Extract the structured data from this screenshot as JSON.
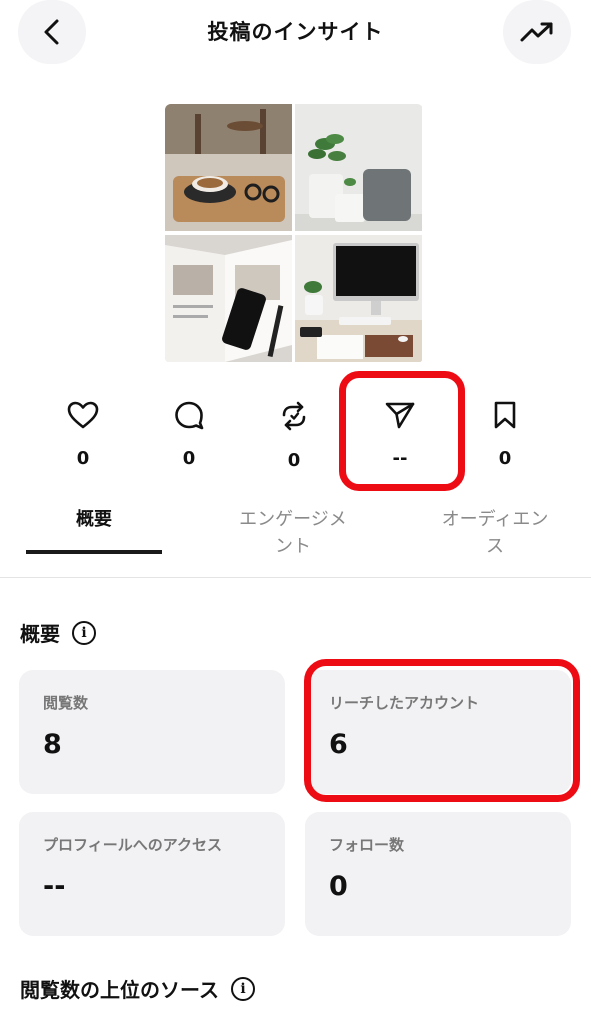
{
  "header": {
    "title": "投稿のインサイト",
    "back_icon": "chevron-left-icon",
    "trend_icon": "trending-up-icon"
  },
  "stats": [
    {
      "icon": "heart-icon",
      "value": "0"
    },
    {
      "icon": "comment-icon",
      "value": "0"
    },
    {
      "icon": "repost-icon",
      "value": "0"
    },
    {
      "icon": "share-icon",
      "value": "--"
    },
    {
      "icon": "bookmark-icon",
      "value": "0"
    }
  ],
  "tabs": [
    {
      "label": "概要"
    },
    {
      "label": "エンゲージメ\nント"
    },
    {
      "label": "オーディエン\nス"
    }
  ],
  "overview": {
    "title": "概要",
    "cards": [
      {
        "label": "閲覧数",
        "value": "8"
      },
      {
        "label": "リーチしたアカウント",
        "value": "6"
      },
      {
        "label": "プロフィールへのアクセス",
        "value": "--"
      },
      {
        "label": "フォロー数",
        "value": "0"
      }
    ]
  },
  "sources": {
    "title": "閲覧数の上位のソース"
  },
  "colors": {
    "highlight": "#ee0c14",
    "card_bg": "#f2f2f4",
    "muted_text": "#8a8a8a"
  }
}
